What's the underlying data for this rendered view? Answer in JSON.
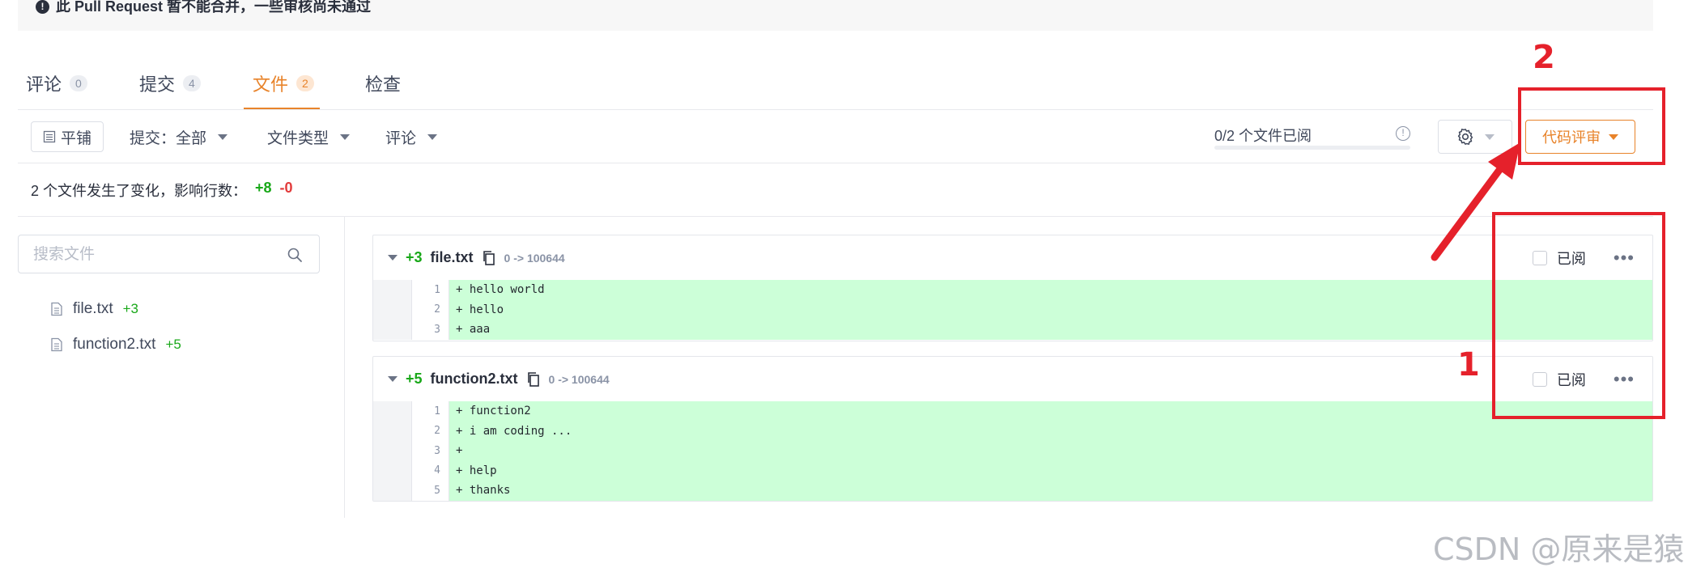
{
  "banner": {
    "text": "此 Pull Request 暂不能合并，一些审核尚未通过"
  },
  "tabs": [
    {
      "label": "评论",
      "count": "0"
    },
    {
      "label": "提交",
      "count": "4"
    },
    {
      "label": "文件",
      "count": "2"
    },
    {
      "label": "检查",
      "count": ""
    }
  ],
  "toolbar": {
    "layout_label": "平铺",
    "commits_label": "提交：全部",
    "file_type_label": "文件类型",
    "comments_label": "评论",
    "viewed_progress": "0/2 个文件已阅",
    "viewed_fraction": 0,
    "review_label": "代码评审"
  },
  "summary": {
    "text": "2 个文件发生了变化，影响行数：",
    "additions": "+8",
    "deletions": "-0"
  },
  "sidebar": {
    "search_placeholder": "搜索文件",
    "files": [
      {
        "name": "file.txt",
        "additions": "+3"
      },
      {
        "name": "function2.txt",
        "additions": "+5"
      }
    ]
  },
  "diffs": [
    {
      "additions": "+3",
      "name": "file.txt",
      "mode": "0 -> 100644",
      "viewed_label": "已阅",
      "lines": [
        {
          "num": "1",
          "text": "+ hello world"
        },
        {
          "num": "2",
          "text": "+ hello"
        },
        {
          "num": "3",
          "text": "+ aaa"
        }
      ]
    },
    {
      "additions": "+5",
      "name": "function2.txt",
      "mode": "0 -> 100644",
      "viewed_label": "已阅",
      "lines": [
        {
          "num": "1",
          "text": "+ function2"
        },
        {
          "num": "2",
          "text": "+ i am coding ..."
        },
        {
          "num": "3",
          "text": "+"
        },
        {
          "num": "4",
          "text": "+ help"
        },
        {
          "num": "5",
          "text": "+ thanks"
        }
      ]
    }
  ],
  "annotations": {
    "label_1": "1",
    "label_2": "2"
  },
  "watermark": "CSDN @原来是猿",
  "colors": {
    "accent": "#e8832a",
    "added_bg": "#ccffd8",
    "annotation_red": "#e5212b",
    "addition_green": "#19a819",
    "deletion_red": "#e23b3b"
  }
}
